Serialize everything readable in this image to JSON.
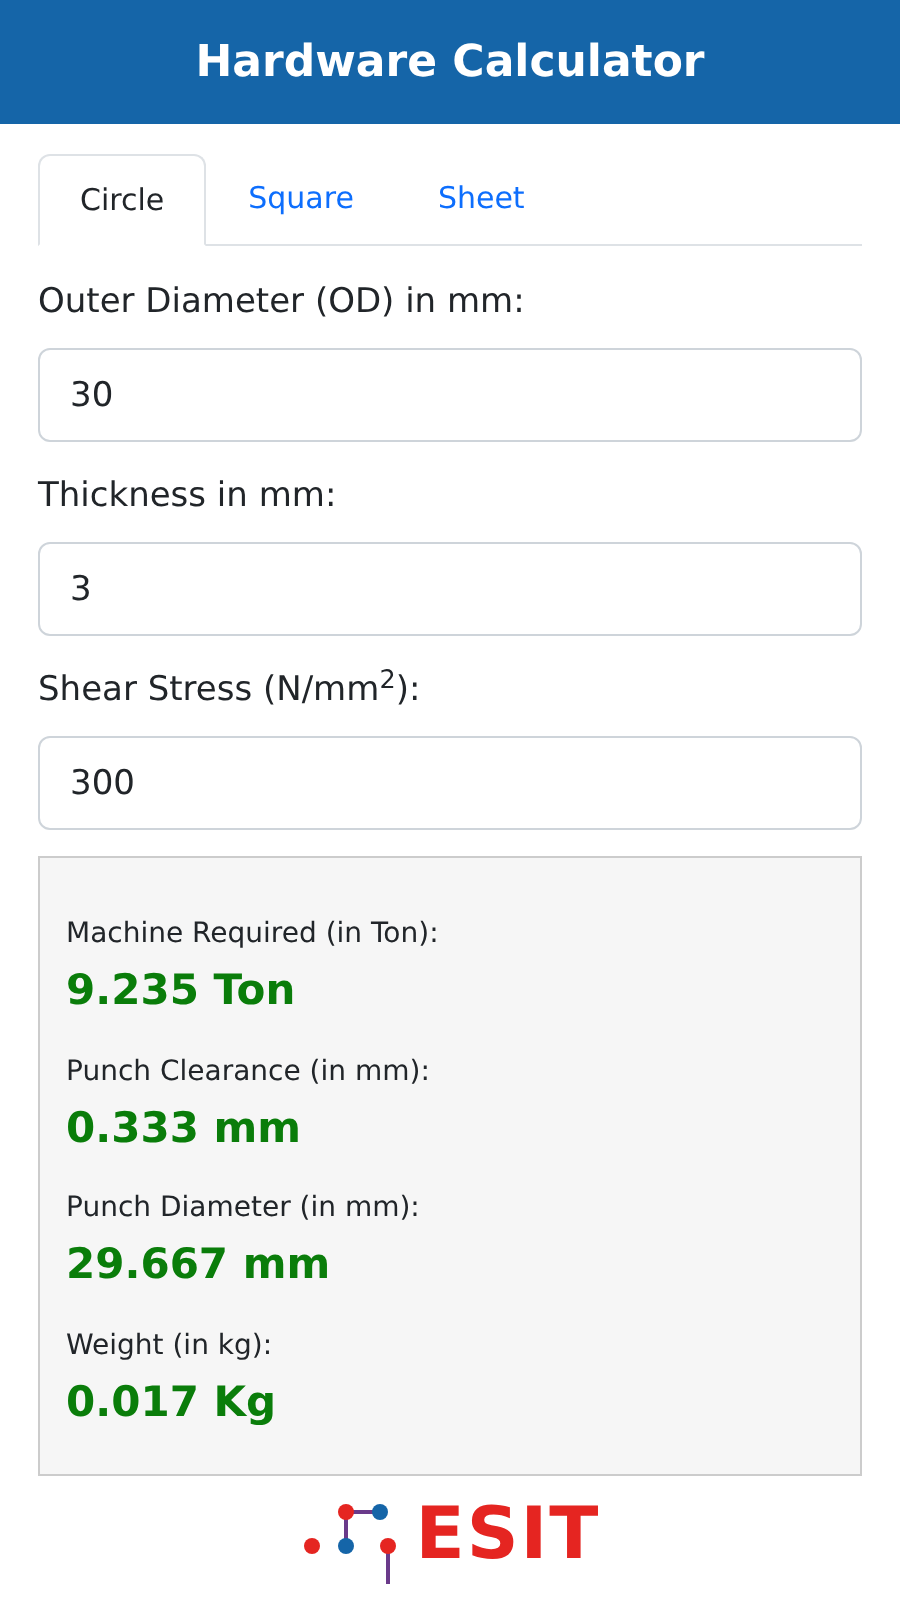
{
  "header": {
    "title": "Hardware Calculator"
  },
  "tabs": [
    {
      "label": "Circle",
      "selected": true
    },
    {
      "label": "Square",
      "selected": false
    },
    {
      "label": "Sheet",
      "selected": false
    }
  ],
  "fields": [
    {
      "label": "Outer Diameter (OD) in mm:",
      "value": "30"
    },
    {
      "label": "Thickness in mm:",
      "value": "3"
    },
    {
      "label": "Shear Stress (N/mm$^{2}$):",
      "value": "300"
    }
  ],
  "results": [
    {
      "label": "Machine Required (in Ton):",
      "value": "9.235 Ton"
    },
    {
      "label": "Punch Clearance (in mm):",
      "value": "0.333 mm"
    },
    {
      "label": "Punch Diameter (in mm):",
      "value": "29.667 mm"
    },
    {
      "label": "Weight (in kg):",
      "value": "0.017 Kg"
    }
  ],
  "logo": {
    "text": "ESIT"
  }
}
